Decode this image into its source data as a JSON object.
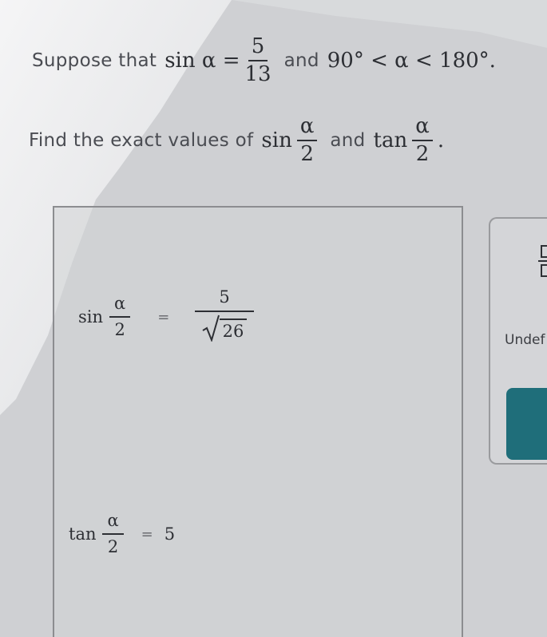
{
  "problem": {
    "line1_prefix": "Suppose that",
    "line1_sin": "sin α =",
    "line1_num": "5",
    "line1_den": "13",
    "line1_and": "and",
    "line1_range": "90° < α < 180°.",
    "line2_prefix": "Find the exact values of",
    "line2_sin": "sin",
    "line2_frac_num": "α",
    "line2_frac_den": "2",
    "line2_and": "and",
    "line2_tan": "tan",
    "line2_frac2_num": "α",
    "line2_frac2_den": "2",
    "line2_period": "."
  },
  "answers": {
    "sin_label": "sin",
    "sin_frac_num": "α",
    "sin_frac_den": "2",
    "sin_equals": "=",
    "sin_value_num": "5",
    "sin_value_radicand": "26",
    "tan_label": "tan",
    "tan_frac_num": "α",
    "tan_frac_den": "2",
    "tan_equals": "=",
    "tan_value": "5"
  },
  "side_panel": {
    "template_icon": "fraction-template-icon",
    "undefined_label": "Undef"
  },
  "colors": {
    "background": "#cfd0d3",
    "text": "#3b3d42",
    "accent_button": "#1f6e7a"
  }
}
